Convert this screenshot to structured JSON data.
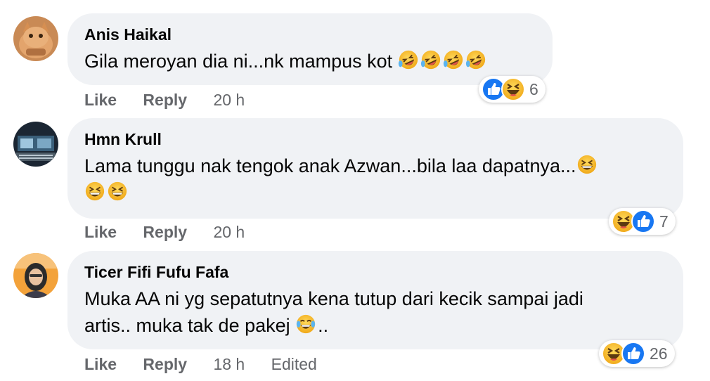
{
  "comments": [
    {
      "author": "Anis Haikal",
      "text_lines": [
        "Gila meroyan dia ni...nk mampus kot"
      ],
      "reactions": {
        "icons": [
          "like-icon",
          "haha-icon"
        ],
        "count": "6"
      },
      "actions": {
        "like": "Like",
        "reply": "Reply",
        "time": "20 h"
      }
    },
    {
      "author": "Hmn Krull",
      "text_lines": [
        "Lama tunggu nak tengok anak Azwan...bila laa dapatnya..."
      ],
      "reactions": {
        "icons": [
          "haha-icon",
          "like-icon"
        ],
        "count": "7"
      },
      "actions": {
        "like": "Like",
        "reply": "Reply",
        "time": "20 h"
      }
    },
    {
      "author": "Ticer Fifi Fufu Fafa",
      "text_lines": [
        "Muka AA ni yg sepatutnya kena tutup dari kecik sampai jadi",
        "artis.. muka tak de pakej",
        ".."
      ],
      "reactions": {
        "icons": [
          "haha-icon",
          "like-icon"
        ],
        "count": "26"
      },
      "actions": {
        "like": "Like",
        "reply": "Reply",
        "time": "18 h",
        "edited": "Edited"
      }
    }
  ],
  "colors": {
    "bubble": "#f0f2f5",
    "meta_text": "#65676b",
    "like_blue": "#1877f2",
    "emoji_yellow": "#f7b125"
  }
}
